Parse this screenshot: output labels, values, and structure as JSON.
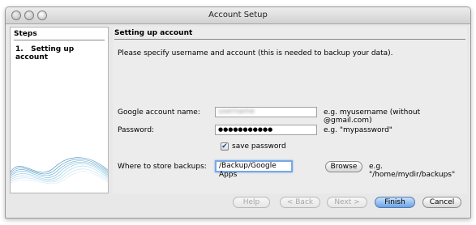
{
  "window": {
    "title": "Account Setup"
  },
  "steps": {
    "header": "Steps",
    "items": [
      {
        "number": "1.",
        "label": "Setting up account"
      }
    ]
  },
  "main": {
    "header": "Setting up account",
    "instructions": "Please specify username and account (this is needed to backup your data)."
  },
  "form": {
    "account": {
      "label": "Google account name:",
      "value": "username",
      "hint": "e.g. myusername (without @gmail.com)"
    },
    "password": {
      "label": "Password:",
      "value": "●●●●●●●●●●●",
      "hint": "e.g. \"mypassword\""
    },
    "save_password": {
      "label": "save password",
      "checked": true,
      "mark": "✔"
    },
    "backup": {
      "label": "Where to store backups:",
      "value": "/Backup/Google Apps",
      "hint": "e.g. \"/home/mydir/backups\""
    },
    "browse_label": "Browse"
  },
  "buttons": {
    "help": "Help",
    "back": "< Back",
    "next": "Next >",
    "finish": "Finish",
    "cancel": "Cancel"
  },
  "colors": {
    "accent": "#6aa5e9",
    "focus": "#7aa7e6"
  }
}
